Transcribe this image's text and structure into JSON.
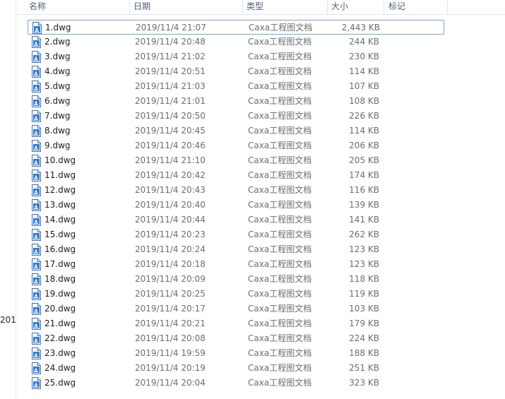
{
  "columns": {
    "name": "名称",
    "date": "日期",
    "type": "类型",
    "size": "大小",
    "tags": "标记"
  },
  "left_pane_clip": "201",
  "selected_index": 0,
  "files": [
    {
      "name": "1.dwg",
      "date": "2019/11/4 21:07",
      "type": "Caxa工程图文档",
      "size": "2,443 KB"
    },
    {
      "name": "2.dwg",
      "date": "2019/11/4 20:48",
      "type": "Caxa工程图文档",
      "size": "244 KB"
    },
    {
      "name": "3.dwg",
      "date": "2019/11/4 21:02",
      "type": "Caxa工程图文档",
      "size": "230 KB"
    },
    {
      "name": "4.dwg",
      "date": "2019/11/4 20:51",
      "type": "Caxa工程图文档",
      "size": "114 KB"
    },
    {
      "name": "5.dwg",
      "date": "2019/11/4 21:03",
      "type": "Caxa工程图文档",
      "size": "107 KB"
    },
    {
      "name": "6.dwg",
      "date": "2019/11/4 21:01",
      "type": "Caxa工程图文档",
      "size": "108 KB"
    },
    {
      "name": "7.dwg",
      "date": "2019/11/4 20:50",
      "type": "Caxa工程图文档",
      "size": "226 KB"
    },
    {
      "name": "8.dwg",
      "date": "2019/11/4 20:45",
      "type": "Caxa工程图文档",
      "size": "114 KB"
    },
    {
      "name": "9.dwg",
      "date": "2019/11/4 20:46",
      "type": "Caxa工程图文档",
      "size": "206 KB"
    },
    {
      "name": "10.dwg",
      "date": "2019/11/4 21:10",
      "type": "Caxa工程图文档",
      "size": "205 KB"
    },
    {
      "name": "11.dwg",
      "date": "2019/11/4 20:42",
      "type": "Caxa工程图文档",
      "size": "174 KB"
    },
    {
      "name": "12.dwg",
      "date": "2019/11/4 20:43",
      "type": "Caxa工程图文档",
      "size": "116 KB"
    },
    {
      "name": "13.dwg",
      "date": "2019/11/4 20:40",
      "type": "Caxa工程图文档",
      "size": "139 KB"
    },
    {
      "name": "14.dwg",
      "date": "2019/11/4 20:44",
      "type": "Caxa工程图文档",
      "size": "141 KB"
    },
    {
      "name": "15.dwg",
      "date": "2019/11/4 20:23",
      "type": "Caxa工程图文档",
      "size": "262 KB"
    },
    {
      "name": "16.dwg",
      "date": "2019/11/4 20:24",
      "type": "Caxa工程图文档",
      "size": "123 KB"
    },
    {
      "name": "17.dwg",
      "date": "2019/11/4 20:18",
      "type": "Caxa工程图文档",
      "size": "123 KB"
    },
    {
      "name": "18.dwg",
      "date": "2019/11/4 20:09",
      "type": "Caxa工程图文档",
      "size": "118 KB"
    },
    {
      "name": "19.dwg",
      "date": "2019/11/4 20:25",
      "type": "Caxa工程图文档",
      "size": "119 KB"
    },
    {
      "name": "20.dwg",
      "date": "2019/11/4 20:17",
      "type": "Caxa工程图文档",
      "size": "103 KB"
    },
    {
      "name": "21.dwg",
      "date": "2019/11/4 20:21",
      "type": "Caxa工程图文档",
      "size": "179 KB"
    },
    {
      "name": "22.dwg",
      "date": "2019/11/4 20:08",
      "type": "Caxa工程图文档",
      "size": "224 KB"
    },
    {
      "name": "23.dwg",
      "date": "2019/11/4 19:59",
      "type": "Caxa工程图文档",
      "size": "188 KB"
    },
    {
      "name": "24.dwg",
      "date": "2019/11/4 20:19",
      "type": "Caxa工程图文档",
      "size": "251 KB"
    },
    {
      "name": "25.dwg",
      "date": "2019/11/4 20:04",
      "type": "Caxa工程图文档",
      "size": "323 KB"
    }
  ],
  "icon": "caxa-dwg-file-icon",
  "colors": {
    "header_text": "#4c607a",
    "selection_border": "#7da2ce",
    "detail_text": "#6d6d6d",
    "icon_blue": "#2f7bd4"
  }
}
